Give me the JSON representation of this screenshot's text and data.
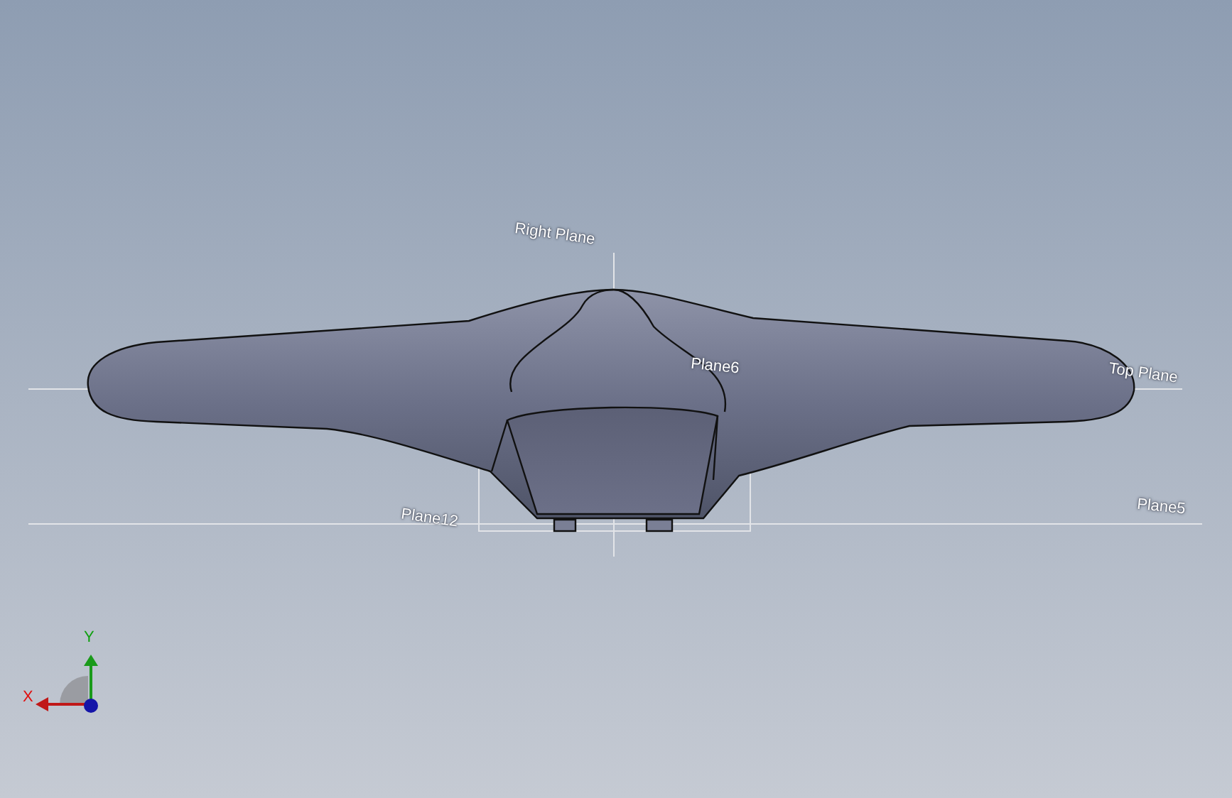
{
  "viewport": {
    "plane_labels": [
      {
        "text": "Right Plane"
      },
      {
        "text": "Plane6"
      },
      {
        "text": "Top Plane"
      },
      {
        "text": "Plane5"
      },
      {
        "text": "Plane12"
      }
    ]
  },
  "triad": {
    "x_label": "X",
    "y_label": "Y"
  }
}
